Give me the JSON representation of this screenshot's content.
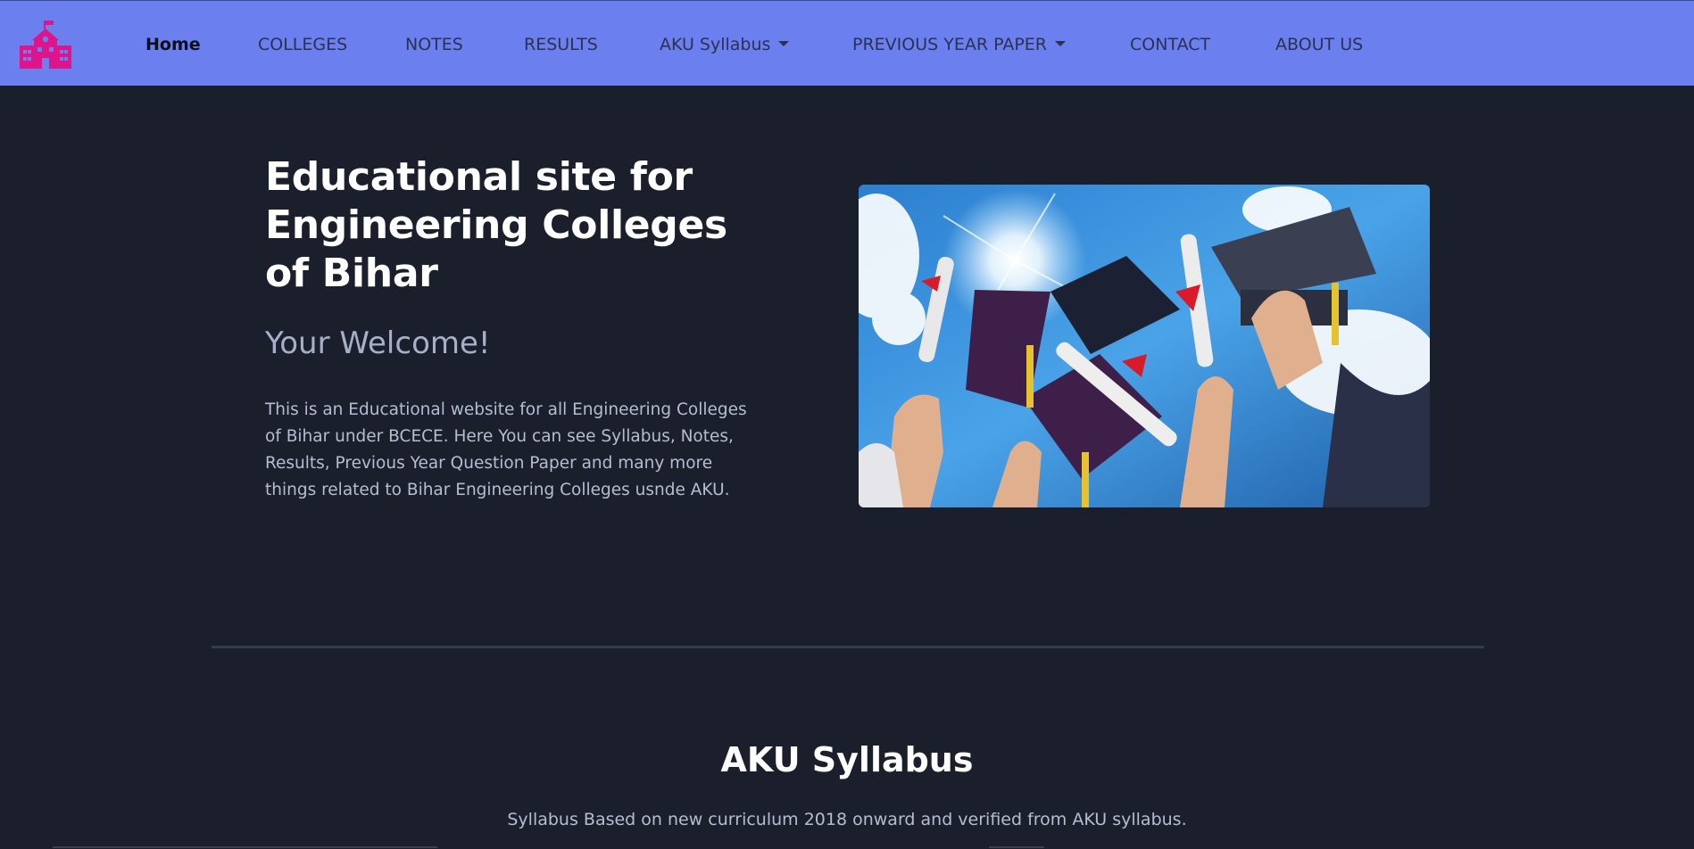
{
  "nav": {
    "logo_icon": "school-building-icon",
    "logo_color": "#e0148a",
    "items": [
      {
        "label": "Home",
        "active": true
      },
      {
        "label": "COLLEGES"
      },
      {
        "label": "NOTES"
      },
      {
        "label": "RESULTS"
      },
      {
        "label": "AKU Syllabus",
        "dropdown": true
      },
      {
        "label": "PREVIOUS YEAR PAPER",
        "dropdown": true
      },
      {
        "label": "CONTACT"
      },
      {
        "label": "ABOUT US"
      }
    ],
    "background": "#6b80ee"
  },
  "hero": {
    "title": "Educational site for Engineering Colleges of Bihar",
    "subtitle": "Your Welcome!",
    "description": "This is an Educational website for all Engineering Colleges of Bihar under BCECE. Here You can see Syllabus, Notes, Results, Previous Year Question Paper and many more things related to Bihar Engineering Colleges usnde AKU.",
    "image": "graduation-caps-and-diplomas-photo"
  },
  "syllabus_section": {
    "title": "AKU Syllabus",
    "description": "Syllabus Based on new curriculum 2018 onward and verified from AKU syllabus."
  },
  "colors": {
    "page_background": "#1b1f2b",
    "muted_text": "#b6bdd1"
  }
}
